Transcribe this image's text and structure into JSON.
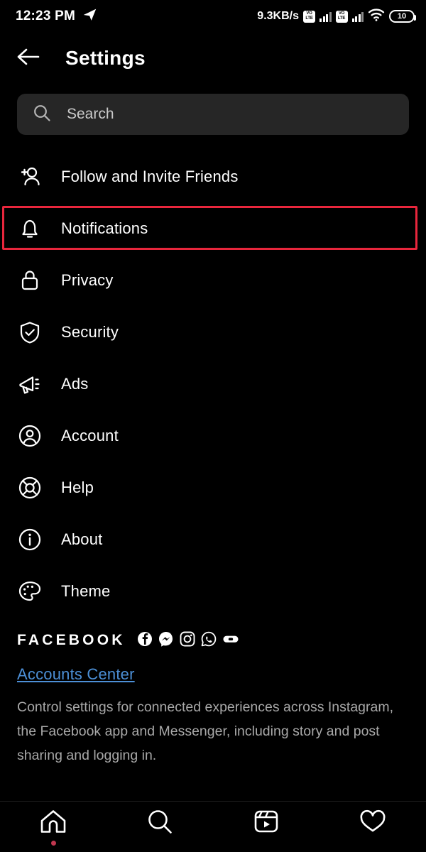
{
  "status_bar": {
    "time": "12:23 PM",
    "app_icon": "telegram-icon",
    "network_speed": "9.3KB/s",
    "sim1_label_top": "VO",
    "sim1_label_bottom": "LTE",
    "sim2_label_top": "VO",
    "sim2_label_bottom": "LTE",
    "wifi_icon": "wifi-icon",
    "battery_level": "10"
  },
  "header": {
    "back_icon": "back-arrow-icon",
    "title": "Settings"
  },
  "search": {
    "icon": "search-icon",
    "placeholder": "Search",
    "value": ""
  },
  "menu": {
    "items": [
      {
        "label": "Follow and Invite Friends",
        "icon": "add-person-icon",
        "highlighted": false
      },
      {
        "label": "Notifications",
        "icon": "bell-icon",
        "highlighted": true
      },
      {
        "label": "Privacy",
        "icon": "lock-icon",
        "highlighted": false
      },
      {
        "label": "Security",
        "icon": "shield-check-icon",
        "highlighted": false
      },
      {
        "label": "Ads",
        "icon": "megaphone-icon",
        "highlighted": false
      },
      {
        "label": "Account",
        "icon": "account-circle-icon",
        "highlighted": false
      },
      {
        "label": "Help",
        "icon": "life-ring-icon",
        "highlighted": false
      },
      {
        "label": "About",
        "icon": "info-circle-icon",
        "highlighted": false
      },
      {
        "label": "Theme",
        "icon": "palette-icon",
        "highlighted": false
      }
    ]
  },
  "facebook_section": {
    "brand_word": "FACEBOOK",
    "app_icons": [
      "facebook-icon",
      "messenger-icon",
      "instagram-icon",
      "whatsapp-icon",
      "oculus-icon"
    ],
    "accounts_center_label": "Accounts Center",
    "description": "Control settings for connected experiences across Instagram, the Facebook app and Messenger, including story and post sharing and logging in."
  },
  "bottom_nav": {
    "items": [
      {
        "icon": "home-icon",
        "badge": true
      },
      {
        "icon": "search-icon",
        "badge": false
      },
      {
        "icon": "reels-icon",
        "badge": false
      },
      {
        "icon": "heart-icon",
        "badge": false
      }
    ]
  },
  "colors": {
    "background": "#000000",
    "search_field": "#262626",
    "highlight_red": "#e8263c",
    "link_blue": "#4c8fd6",
    "muted_text": "#a8a8a8",
    "badge_red": "#c1374f"
  }
}
